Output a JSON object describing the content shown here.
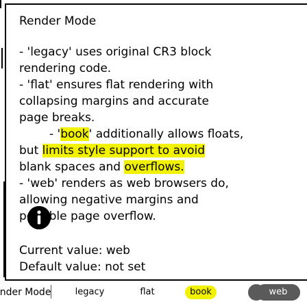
{
  "popup": {
    "title": "Render Mode",
    "lines": [
      "- 'legacy' uses original CR3 block",
      "rendering code.",
      "- 'flat' ensures flat rendering with",
      "collapsing margins and accurate",
      "page breaks.",
      "- 'book' additionally allows floats,",
      "but limits style support to avoid",
      "blank spaces and overflows.",
      "- 'web' renders as web browsers do,",
      "allowing negative margins and",
      "possible page overflow."
    ],
    "book_line": {
      "prefix": "- '",
      "highlight": "book",
      "suffix": "' additionally allows floats,"
    },
    "limits_line": {
      "prefix": "but ",
      "highlight": "limits style support to avoid"
    },
    "blank_line": {
      "prefix": "blank spaces and ",
      "highlight": "overflows."
    },
    "current_value": "Current value: web",
    "default_value": "Default value: not set"
  },
  "mode_bar": {
    "label": "Render Mode",
    "options": [
      "legacy",
      "flat",
      "book",
      "web"
    ],
    "selected": "web"
  },
  "colors": {
    "highlight": "#f2f200",
    "selected_bg": "#5a5a5a"
  },
  "icons": {
    "info": "info-icon"
  }
}
